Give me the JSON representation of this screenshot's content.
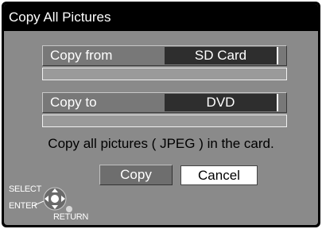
{
  "title": "Copy All Pictures",
  "copy_from": {
    "label": "Copy from",
    "value": "SD Card"
  },
  "copy_to": {
    "label": "Copy to",
    "value": "DVD"
  },
  "message": "Copy all pictures ( JPEG ) in the card.",
  "buttons": {
    "copy": "Copy",
    "cancel": "Cancel"
  },
  "nav": {
    "select": "SELECT",
    "enter": "ENTER",
    "return": "RETURN"
  }
}
